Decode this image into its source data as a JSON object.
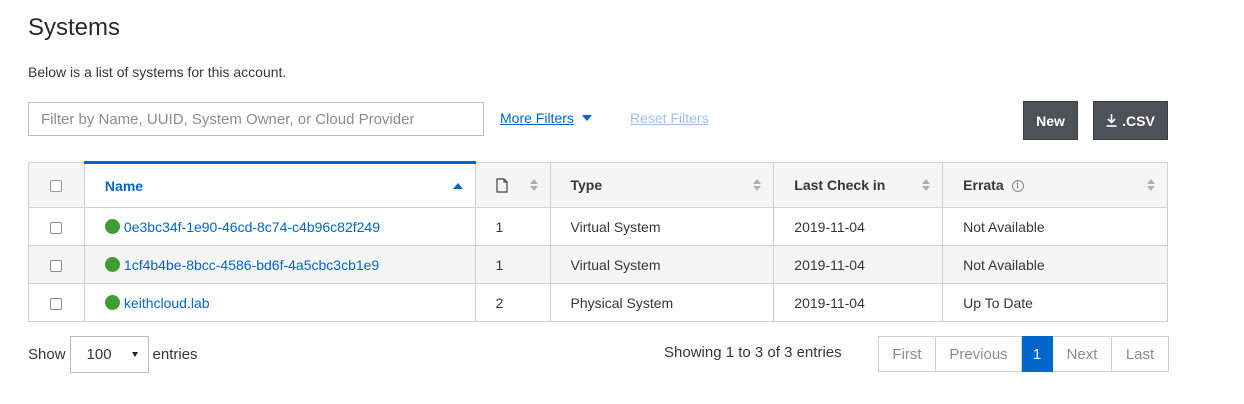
{
  "page": {
    "title": "Systems",
    "subtitle": "Below is a list of systems for this account."
  },
  "filters": {
    "search_placeholder": "Filter by Name, UUID, System Owner, or Cloud Provider",
    "search_value": "",
    "more_filters_label": "More Filters",
    "reset_filters_label": "Reset Filters"
  },
  "actions": {
    "new_label": "New",
    "csv_label": ".CSV"
  },
  "table": {
    "columns": {
      "name": "Name",
      "subscriptions_icon": "document-icon",
      "type": "Type",
      "last_check_in": "Last Check in",
      "errata": "Errata"
    },
    "sorted_column": "Name",
    "rows": [
      {
        "status_color": "#3f9c35",
        "name": "0e3bc34f-1e90-46cd-8c74-c4b96c82f249",
        "subscriptions": "1",
        "type": "Virtual System",
        "last_check_in": "2019-11-04",
        "errata": "Not Available"
      },
      {
        "status_color": "#3f9c35",
        "name": "1cf4b4be-8bcc-4586-bd6f-4a5cbc3cb1e9",
        "subscriptions": "1",
        "type": "Virtual System",
        "last_check_in": "2019-11-04",
        "errata": "Not Available"
      },
      {
        "status_color": "#3f9c35",
        "name": "keithcloud.lab",
        "subscriptions": "2",
        "type": "Physical System",
        "last_check_in": "2019-11-04",
        "errata": "Up To Date"
      }
    ]
  },
  "footer": {
    "show_label": "Show",
    "entries_value": "100",
    "entries_label": "entries",
    "showing_text": "Showing 1 to 3 of 3 entries",
    "pagination": {
      "first": "First",
      "previous": "Previous",
      "current": "1",
      "next": "Next",
      "last": "Last"
    }
  },
  "colors": {
    "accent": "#0066cc",
    "dark_button": "#4d5258",
    "status_ok": "#3f9c35"
  }
}
